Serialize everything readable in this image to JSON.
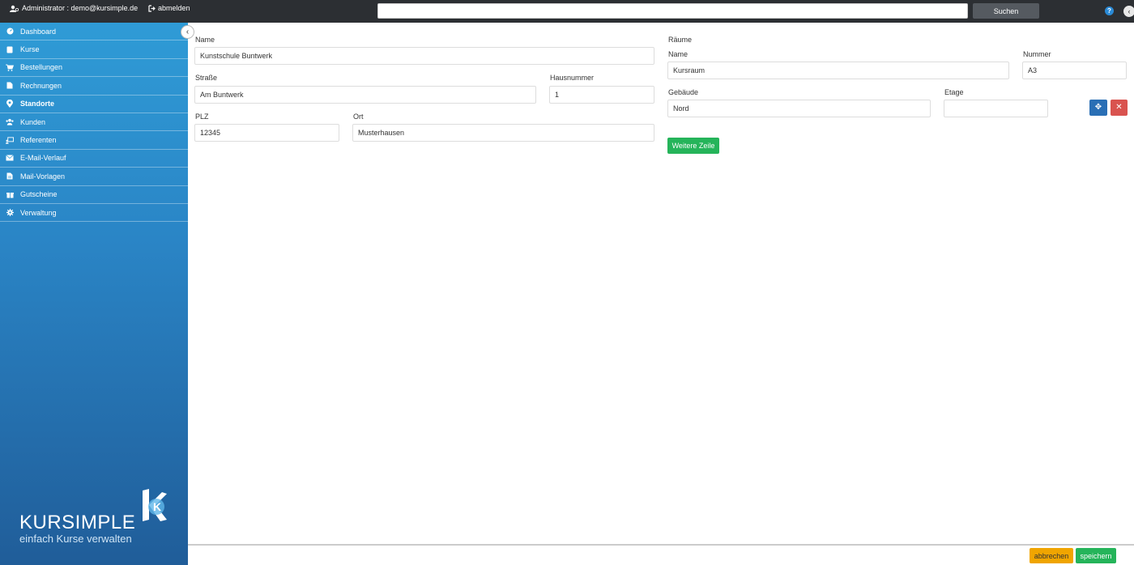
{
  "topbar": {
    "user_label": "Administrator : demo@kursimple.de",
    "logout_label": "abmelden",
    "search_value": "",
    "search_button": "Suchen",
    "help_glyph": "?"
  },
  "sidebar": {
    "items": [
      {
        "label": "Dashboard",
        "icon": "dashboard-icon"
      },
      {
        "label": "Kurse",
        "icon": "book-icon"
      },
      {
        "label": "Bestellungen",
        "icon": "cart-icon"
      },
      {
        "label": "Rechnungen",
        "icon": "document-icon"
      },
      {
        "label": "Standorte",
        "icon": "location-icon",
        "active": true
      },
      {
        "label": "Kunden",
        "icon": "users-icon"
      },
      {
        "label": "Referenten",
        "icon": "teacher-icon"
      },
      {
        "label": "E-Mail-Verlauf",
        "icon": "envelope-icon"
      },
      {
        "label": "Mail-Vorlagen",
        "icon": "template-icon"
      },
      {
        "label": "Gutscheine",
        "icon": "gift-icon"
      },
      {
        "label": "Verwaltung",
        "icon": "gear-icon"
      }
    ],
    "logo_text": "KURSIMPLE",
    "logo_tagline": "einfach Kurse verwalten",
    "logo_letter": "K"
  },
  "form": {
    "name_label": "Name",
    "name_value": "Kunstschule Buntwerk",
    "street_label": "Straße",
    "street_value": "Am Buntwerk",
    "housenumber_label": "Hausnummer",
    "housenumber_value": "1",
    "zip_label": "PLZ",
    "zip_value": "12345",
    "city_label": "Ort",
    "city_value": "Musterhausen"
  },
  "rooms": {
    "section_label": "Räume",
    "name_label": "Name",
    "name_value": "Kursraum",
    "number_label": "Nummer",
    "number_value": "A3",
    "building_label": "Gebäude",
    "building_value": "Nord",
    "floor_label": "Etage",
    "floor_value": "",
    "add_row_button": "Weitere Zeile",
    "move_glyph": "✥",
    "delete_glyph": "✕"
  },
  "footer": {
    "cancel_button": "abbrechen",
    "save_button": "speichern"
  },
  "colors": {
    "topbar": "#2c2f33",
    "sidebar_top": "#2f9bd6",
    "sidebar_bottom": "#205d99",
    "success": "#25b45a",
    "warning": "#f0a500",
    "danger": "#d9534f",
    "primary": "#2a6fb5"
  }
}
